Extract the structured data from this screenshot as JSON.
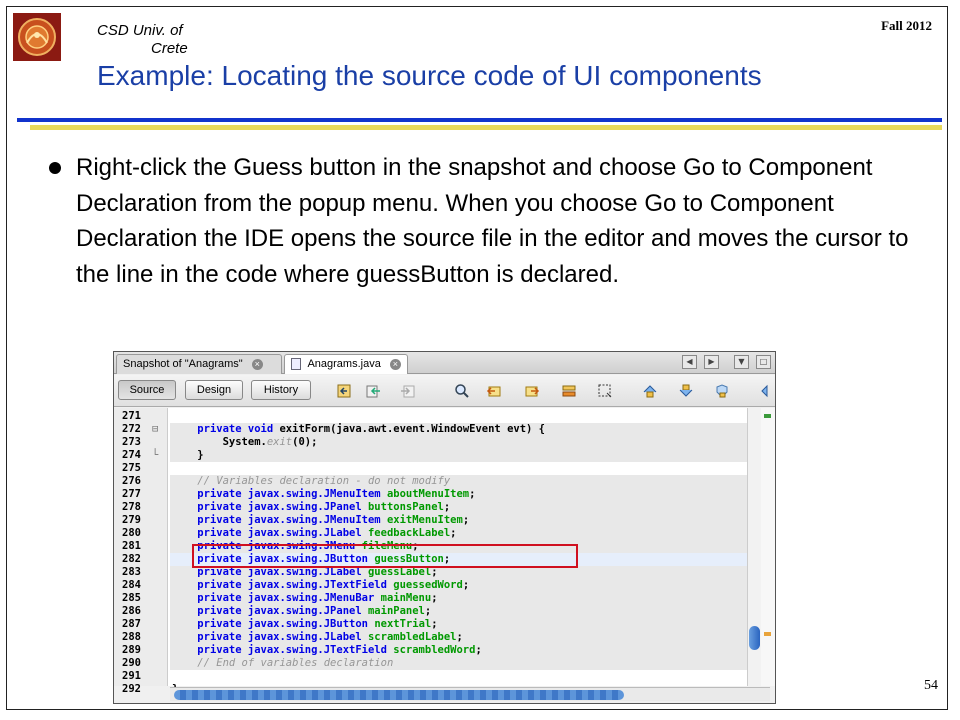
{
  "header": {
    "university_line1": "CSD Univ. of",
    "university_line2": "Crete",
    "term": "Fall 2012",
    "title": "Example: Locating the source code of UI components"
  },
  "body": {
    "bullet": "Right-click the Guess button in the snapshot and choose Go to Component Declaration from the popup menu. When you choose Go to Component Declaration the IDE opens the source file in the editor and moves the cursor to the line in the code where guessButton is declared."
  },
  "page_number": "54",
  "ide": {
    "tabs": [
      {
        "label": "Snapshot of \"Anagrams\"",
        "active": false
      },
      {
        "label": "Anagrams.java",
        "active": true
      }
    ],
    "modes": [
      "Source",
      "Design",
      "History"
    ],
    "active_mode": "Source",
    "lines": [
      {
        "num": "271",
        "parts": []
      },
      {
        "num": "272",
        "fold": "⊟",
        "parts": [
          [
            "kw",
            "private void "
          ],
          [
            "mth",
            "exitForm"
          ],
          [
            "",
            "(java.awt.event.WindowEvent evt) {"
          ]
        ]
      },
      {
        "num": "273",
        "parts": [
          [
            "",
            "    System."
          ],
          [
            "cm",
            "exit"
          ],
          [
            "",
            "(0);"
          ]
        ]
      },
      {
        "num": "274",
        "fold": "└",
        "parts": [
          [
            "",
            "}"
          ]
        ]
      },
      {
        "num": "275",
        "parts": []
      },
      {
        "num": "276",
        "parts": [
          [
            "cm",
            "// Variables declaration - do not modify"
          ]
        ]
      },
      {
        "num": "277",
        "parts": [
          [
            "kw",
            "private javax.swing.JMenuItem "
          ],
          [
            "id",
            "aboutMenuItem"
          ],
          [
            "",
            ";"
          ]
        ]
      },
      {
        "num": "278",
        "parts": [
          [
            "kw",
            "private javax.swing.JPanel "
          ],
          [
            "id",
            "buttonsPanel"
          ],
          [
            "",
            ";"
          ]
        ]
      },
      {
        "num": "279",
        "parts": [
          [
            "kw",
            "private javax.swing.JMenuItem "
          ],
          [
            "id",
            "exitMenuItem"
          ],
          [
            "",
            ";"
          ]
        ]
      },
      {
        "num": "280",
        "parts": [
          [
            "kw",
            "private javax.swing.JLabel "
          ],
          [
            "id",
            "feedbackLabel"
          ],
          [
            "",
            ";"
          ]
        ]
      },
      {
        "num": "281",
        "parts": [
          [
            "kw",
            "private javax.swing.JMenu "
          ],
          [
            "id",
            "fileMenu"
          ],
          [
            "",
            ";"
          ]
        ]
      },
      {
        "num": "282",
        "parts": [
          [
            "kw",
            "private javax.swing.JButton "
          ],
          [
            "id",
            "guessButton"
          ],
          [
            "",
            ";"
          ]
        ]
      },
      {
        "num": "283",
        "parts": [
          [
            "kw",
            "private javax.swing.JLabel "
          ],
          [
            "id",
            "guessLabel"
          ],
          [
            "",
            ";"
          ]
        ]
      },
      {
        "num": "284",
        "parts": [
          [
            "kw",
            "private javax.swing.JTextField "
          ],
          [
            "id",
            "guessedWord"
          ],
          [
            "",
            ";"
          ]
        ]
      },
      {
        "num": "285",
        "parts": [
          [
            "kw",
            "private javax.swing.JMenuBar "
          ],
          [
            "id",
            "mainMenu"
          ],
          [
            "",
            ";"
          ]
        ]
      },
      {
        "num": "286",
        "parts": [
          [
            "kw",
            "private javax.swing.JPanel "
          ],
          [
            "id",
            "mainPanel"
          ],
          [
            "",
            ";"
          ]
        ]
      },
      {
        "num": "287",
        "parts": [
          [
            "kw",
            "private javax.swing.JButton "
          ],
          [
            "id",
            "nextTrial"
          ],
          [
            "",
            ";"
          ]
        ]
      },
      {
        "num": "288",
        "parts": [
          [
            "kw",
            "private javax.swing.JLabel "
          ],
          [
            "id",
            "scrambledLabel"
          ],
          [
            "",
            ";"
          ]
        ]
      },
      {
        "num": "289",
        "parts": [
          [
            "kw",
            "private javax.swing.JTextField "
          ],
          [
            "id",
            "scrambledWord"
          ],
          [
            "",
            ";"
          ]
        ]
      },
      {
        "num": "290",
        "parts": [
          [
            "cm",
            "// End of variables declaration"
          ]
        ]
      },
      {
        "num": "291",
        "parts": []
      },
      {
        "num": "292",
        "parts": [
          [
            "",
            "}"
          ]
        ]
      }
    ],
    "highlighted_line": "282",
    "colors": {
      "keyword": "#0000e6",
      "identifier": "#009900",
      "comment": "#969696",
      "highlight_box": "#d01020",
      "title": "#1a3fa6"
    }
  }
}
